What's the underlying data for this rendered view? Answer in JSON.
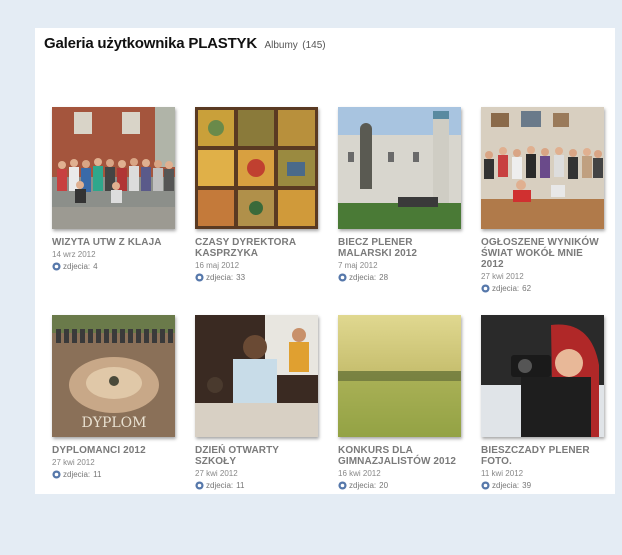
{
  "gallery": {
    "title": "Galeria użytkownika PLASTYK",
    "albums_label": "Albumy",
    "albums_count": "(145)"
  },
  "photos_label": "zdjecia:",
  "albums": [
    {
      "title": "WIZYTA UTW Z KLAJA",
      "date": "14 wrz 2012",
      "photos": "4"
    },
    {
      "title": "CZASY DYREKTORA KASPRZYKA",
      "date": "16 maj 2012",
      "photos": "33"
    },
    {
      "title": "BIECZ PLENER MALARSKI 2012",
      "date": "7 maj 2012",
      "photos": "28"
    },
    {
      "title": "OGŁOSZENE WYNIKÓW ŚWIAT WOKÓŁ MNIE 2012",
      "date": "27 kwi 2012",
      "photos": "62"
    },
    {
      "title": "DYPLOMANCI 2012",
      "date": "27 kwi 2012",
      "photos": "11"
    },
    {
      "title": "DZIEŃ OTWARTY SZKOŁY",
      "date": "27 kwi 2012",
      "photos": "11"
    },
    {
      "title": "KONKURS DLA GIMNAZJALISTÓW 2012",
      "date": "16 kwi 2012",
      "photos": "20"
    },
    {
      "title": "BIESZCZADY PLENER FOTO.",
      "date": "11 kwi 2012",
      "photos": "39"
    }
  ]
}
